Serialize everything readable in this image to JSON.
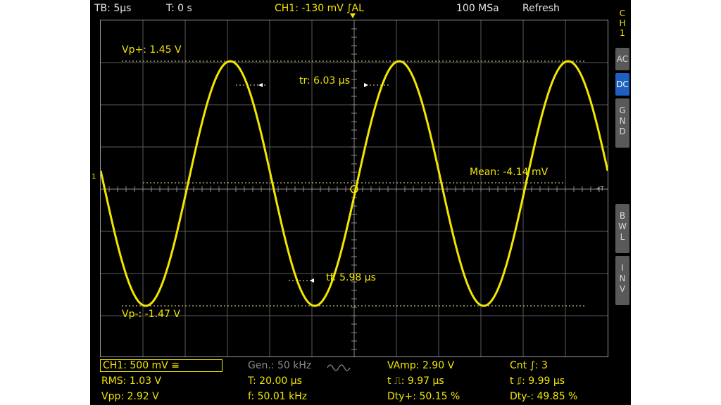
{
  "top": {
    "timebase": "TB: 5µs",
    "trigger_time": "T: 0 s",
    "channel_trigger": "CH1: -130 mV ∫AL",
    "sample_rate": "100 MSa",
    "mode": "Refresh"
  },
  "side": {
    "channel": [
      "C",
      "H",
      "1"
    ],
    "buttons": {
      "ac": "AC",
      "dc": "DC",
      "gnd": [
        "G",
        "N",
        "D"
      ],
      "bwl": [
        "B",
        "W",
        "L"
      ],
      "inv": [
        "I",
        "N",
        "V"
      ]
    }
  },
  "cursors": {
    "vp_plus": "Vp+: 1.45 V",
    "vp_minus": "Vp-: -1.47 V",
    "tr": "tr: 6.03 µs",
    "tf": "tf: 5.98 µs",
    "mean": "Mean: -4.14 mV"
  },
  "measurements": {
    "channel": "CH1: 500 mV ≅",
    "generator": "Gen.: 50 kHz",
    "vamp": "VAmp: 2.90 V",
    "cnt": "Cnt ∫: 3",
    "rms": "RMS: 1.03 V",
    "period": "T: 20.00 µs",
    "t_pos": "t ⎍: 9.97 µs",
    "t_neg": "t ⎎: 9.99 µs",
    "vpp": "Vpp: 2.92 V",
    "freq": "f: 50.01 kHz",
    "dty_pos": "Dty+: 50.15 %",
    "dty_neg": "Dty-: 49.85 %"
  },
  "markers": {
    "ch1_marker": "1",
    "trigger_marker": "+T"
  },
  "colors": {
    "trace": "#f2e600",
    "grid": "#6a6a6a",
    "background": "#000000",
    "active_button": "#1f5fbf"
  }
}
